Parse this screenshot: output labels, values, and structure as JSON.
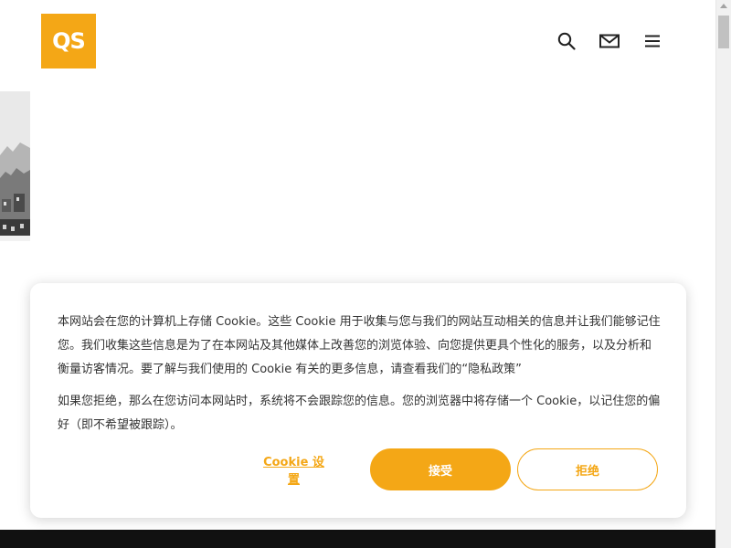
{
  "header": {
    "logo_text": "QS",
    "icons": [
      "search-icon",
      "mail-icon",
      "menu-icon"
    ]
  },
  "cookie_banner": {
    "paragraph1_main": "本网站会在您的计算机上存储 Cookie。这些 Cookie 用于收集与您与我们的网站互动相关的信息并让我们能够记住您。我们收集这些信息是为了在本网站及其他媒体上改善您的浏览体验、向您提供更具个性化的服务，以及分析和衡量访客情况。要了解与我们使用的 Cookie 有关的更多信息，请查看我们的",
    "policy_link": "“隐私政策”",
    "paragraph2": "如果您拒绝，那么在您访问本网站时，系统将不会跟踪您的信息。您的浏览器中将存储一个 Cookie，以记住您的偏好（即不希望被跟踪）。",
    "settings_label": "Cookie 设置",
    "accept_label": "接受",
    "reject_label": "拒绝"
  },
  "colors": {
    "brand": "#f4a716",
    "text": "#333333",
    "footer": "#111111"
  }
}
